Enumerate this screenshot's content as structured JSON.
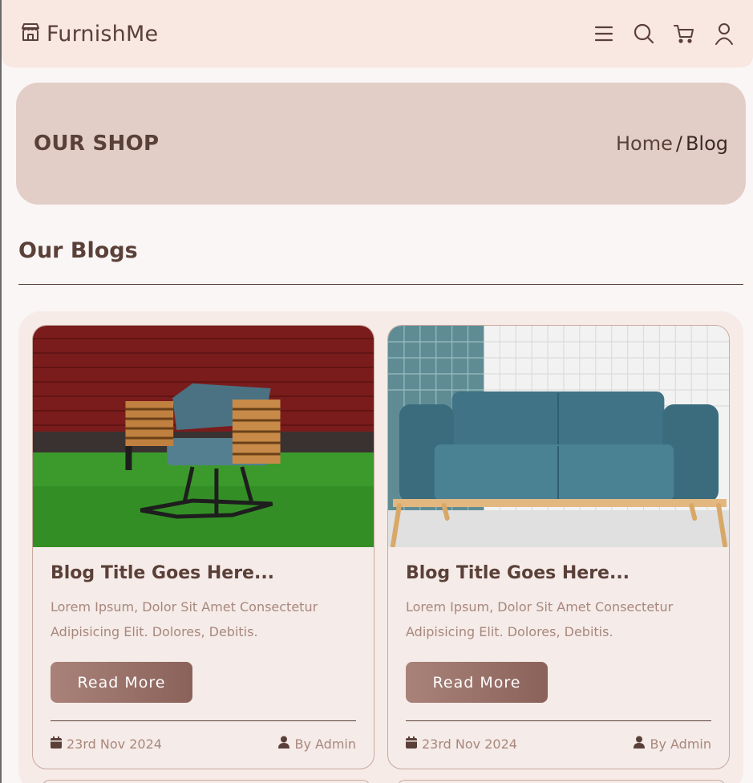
{
  "brand": {
    "name": "FurnishMe",
    "icon": "storefront-icon"
  },
  "nav": {
    "icons": [
      "menu-icon",
      "search-icon",
      "cart-icon",
      "user-icon"
    ]
  },
  "banner": {
    "title": "OUR SHOP",
    "breadcrumb": {
      "home": "Home",
      "separator": "/",
      "current": "Blog"
    }
  },
  "section": {
    "title": "Our Blogs"
  },
  "cards": [
    {
      "title": "Blog Title Goes Here...",
      "text": "Lorem Ipsum, Dolor Sit Amet Consectetur Adipisicing Elit. Dolores, Debitis.",
      "button": "Read More",
      "date": "23rd Nov 2024",
      "author": "By Admin",
      "image": "armchair-on-grass-photo"
    },
    {
      "title": "Blog Title Goes Here...",
      "text": "Lorem Ipsum, Dolor Sit Amet Consectetur Adipisicing Elit. Dolores, Debitis.",
      "button": "Read More",
      "date": "23rd Nov 2024",
      "author": "By Admin",
      "image": "blue-sofa-photo"
    }
  ],
  "colors": {
    "header_bg": "#f9e7e2",
    "banner_bg": "#e2cec7",
    "text_brown": "#5a4038",
    "muted": "#a8877c",
    "button_start": "#a98279",
    "button_end": "#8a625a"
  }
}
